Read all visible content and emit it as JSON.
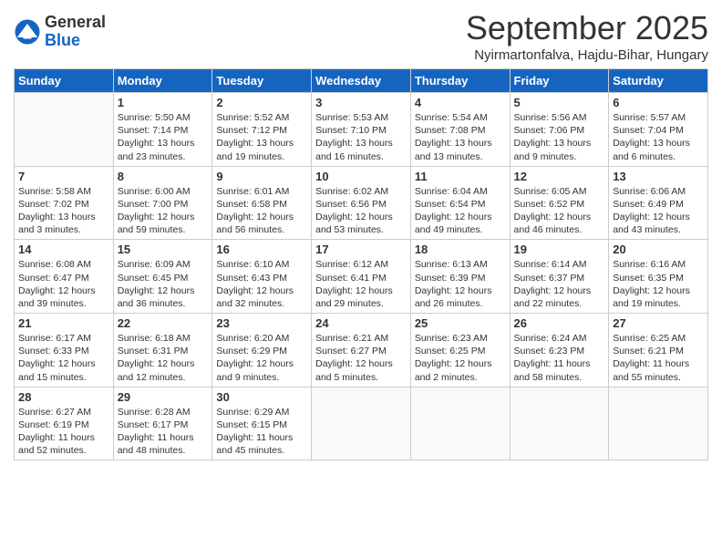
{
  "header": {
    "logo_general": "General",
    "logo_blue": "Blue",
    "title": "September 2025",
    "location": "Nyirmartonfalva, Hajdu-Bihar, Hungary"
  },
  "weekdays": [
    "Sunday",
    "Monday",
    "Tuesday",
    "Wednesday",
    "Thursday",
    "Friday",
    "Saturday"
  ],
  "weeks": [
    [
      {
        "day": "",
        "info": ""
      },
      {
        "day": "1",
        "info": "Sunrise: 5:50 AM\nSunset: 7:14 PM\nDaylight: 13 hours\nand 23 minutes."
      },
      {
        "day": "2",
        "info": "Sunrise: 5:52 AM\nSunset: 7:12 PM\nDaylight: 13 hours\nand 19 minutes."
      },
      {
        "day": "3",
        "info": "Sunrise: 5:53 AM\nSunset: 7:10 PM\nDaylight: 13 hours\nand 16 minutes."
      },
      {
        "day": "4",
        "info": "Sunrise: 5:54 AM\nSunset: 7:08 PM\nDaylight: 13 hours\nand 13 minutes."
      },
      {
        "day": "5",
        "info": "Sunrise: 5:56 AM\nSunset: 7:06 PM\nDaylight: 13 hours\nand 9 minutes."
      },
      {
        "day": "6",
        "info": "Sunrise: 5:57 AM\nSunset: 7:04 PM\nDaylight: 13 hours\nand 6 minutes."
      }
    ],
    [
      {
        "day": "7",
        "info": "Sunrise: 5:58 AM\nSunset: 7:02 PM\nDaylight: 13 hours\nand 3 minutes."
      },
      {
        "day": "8",
        "info": "Sunrise: 6:00 AM\nSunset: 7:00 PM\nDaylight: 12 hours\nand 59 minutes."
      },
      {
        "day": "9",
        "info": "Sunrise: 6:01 AM\nSunset: 6:58 PM\nDaylight: 12 hours\nand 56 minutes."
      },
      {
        "day": "10",
        "info": "Sunrise: 6:02 AM\nSunset: 6:56 PM\nDaylight: 12 hours\nand 53 minutes."
      },
      {
        "day": "11",
        "info": "Sunrise: 6:04 AM\nSunset: 6:54 PM\nDaylight: 12 hours\nand 49 minutes."
      },
      {
        "day": "12",
        "info": "Sunrise: 6:05 AM\nSunset: 6:52 PM\nDaylight: 12 hours\nand 46 minutes."
      },
      {
        "day": "13",
        "info": "Sunrise: 6:06 AM\nSunset: 6:49 PM\nDaylight: 12 hours\nand 43 minutes."
      }
    ],
    [
      {
        "day": "14",
        "info": "Sunrise: 6:08 AM\nSunset: 6:47 PM\nDaylight: 12 hours\nand 39 minutes."
      },
      {
        "day": "15",
        "info": "Sunrise: 6:09 AM\nSunset: 6:45 PM\nDaylight: 12 hours\nand 36 minutes."
      },
      {
        "day": "16",
        "info": "Sunrise: 6:10 AM\nSunset: 6:43 PM\nDaylight: 12 hours\nand 32 minutes."
      },
      {
        "day": "17",
        "info": "Sunrise: 6:12 AM\nSunset: 6:41 PM\nDaylight: 12 hours\nand 29 minutes."
      },
      {
        "day": "18",
        "info": "Sunrise: 6:13 AM\nSunset: 6:39 PM\nDaylight: 12 hours\nand 26 minutes."
      },
      {
        "day": "19",
        "info": "Sunrise: 6:14 AM\nSunset: 6:37 PM\nDaylight: 12 hours\nand 22 minutes."
      },
      {
        "day": "20",
        "info": "Sunrise: 6:16 AM\nSunset: 6:35 PM\nDaylight: 12 hours\nand 19 minutes."
      }
    ],
    [
      {
        "day": "21",
        "info": "Sunrise: 6:17 AM\nSunset: 6:33 PM\nDaylight: 12 hours\nand 15 minutes."
      },
      {
        "day": "22",
        "info": "Sunrise: 6:18 AM\nSunset: 6:31 PM\nDaylight: 12 hours\nand 12 minutes."
      },
      {
        "day": "23",
        "info": "Sunrise: 6:20 AM\nSunset: 6:29 PM\nDaylight: 12 hours\nand 9 minutes."
      },
      {
        "day": "24",
        "info": "Sunrise: 6:21 AM\nSunset: 6:27 PM\nDaylight: 12 hours\nand 5 minutes."
      },
      {
        "day": "25",
        "info": "Sunrise: 6:23 AM\nSunset: 6:25 PM\nDaylight: 12 hours\nand 2 minutes."
      },
      {
        "day": "26",
        "info": "Sunrise: 6:24 AM\nSunset: 6:23 PM\nDaylight: 11 hours\nand 58 minutes."
      },
      {
        "day": "27",
        "info": "Sunrise: 6:25 AM\nSunset: 6:21 PM\nDaylight: 11 hours\nand 55 minutes."
      }
    ],
    [
      {
        "day": "28",
        "info": "Sunrise: 6:27 AM\nSunset: 6:19 PM\nDaylight: 11 hours\nand 52 minutes."
      },
      {
        "day": "29",
        "info": "Sunrise: 6:28 AM\nSunset: 6:17 PM\nDaylight: 11 hours\nand 48 minutes."
      },
      {
        "day": "30",
        "info": "Sunrise: 6:29 AM\nSunset: 6:15 PM\nDaylight: 11 hours\nand 45 minutes."
      },
      {
        "day": "",
        "info": ""
      },
      {
        "day": "",
        "info": ""
      },
      {
        "day": "",
        "info": ""
      },
      {
        "day": "",
        "info": ""
      }
    ]
  ]
}
